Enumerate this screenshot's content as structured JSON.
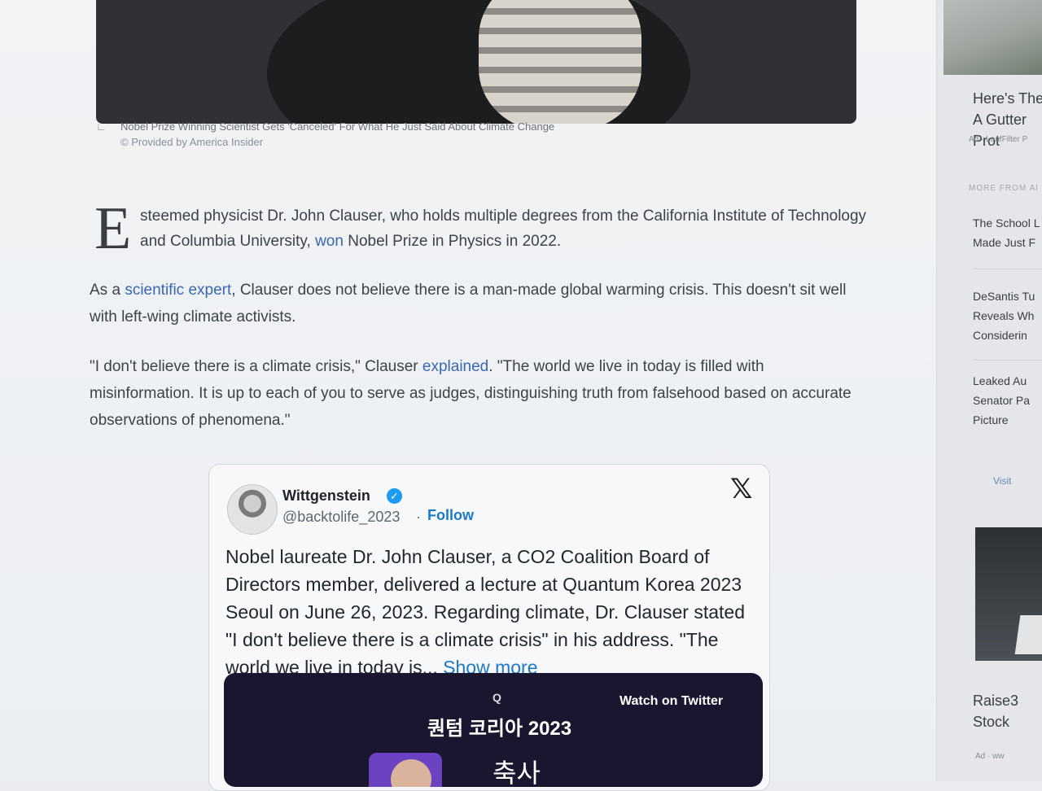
{
  "caption": {
    "title": "Nobel Prize Winning Scientist Gets 'Canceled' For What He Just Said About Climate Change",
    "credit": "© Provided by America Insider"
  },
  "article": {
    "dropcap": "E",
    "p1_a": "steemed physicist Dr. John Clauser, who holds multiple degrees from the California Institute of Technology and Columbia University, ",
    "p1_link": "won",
    "p1_b": " Nobel Prize in Physics in 2022.",
    "p2_a": "As a ",
    "p2_link": "scientific expert",
    "p2_b": ", Clauser does not believe there is a man-made global warming crisis. This doesn't sit well with left-wing climate activists.",
    "p3_a": "\"I don't believe there is a climate crisis,\" Clauser ",
    "p3_link": "explained",
    "p3_b": ". \"The world we live in today is filled with misinformation. It is up to each of you to serve as judges, distinguishing truth from falsehood based on accurate observations of phenomena.\""
  },
  "tweet": {
    "name": "Wittgenstein",
    "handle": "@backtolife_2023",
    "separator": "·",
    "follow": "Follow",
    "text": "Nobel laureate Dr. John Clauser, a CO2 Coalition Board of Directors member, delivered a lecture at Quantum Korea 2023 Seoul on June 26, 2023.  Regarding climate, Dr. Clauser stated \"I don't believe there is a climate crisis\" in his address.    \"The world we live in today is...",
    "show_more": "Show more",
    "video": {
      "logo": "Q",
      "title": "퀀텀 코리아 2023",
      "watch": "Watch on Twitter",
      "subtitle": "축사"
    },
    "icons": {
      "verified": "verified-badge-icon",
      "platform": "x-logo-icon"
    },
    "accent_color": "#1d9bf0"
  },
  "sidebar": {
    "card1_title": "Here's The A Gutter Prot",
    "card1_ad": "Ad · LeafFilter P",
    "more_from": "MORE FROM AI",
    "item1": "The School L Made Just F",
    "item2": "DeSantis Tu Reveals Wh Considerin",
    "item3": "Leaked Au Senator Pa Picture",
    "visit": "Visit",
    "card2_title": "Raise3 Stock",
    "card2_ad": "Ad · ww"
  }
}
